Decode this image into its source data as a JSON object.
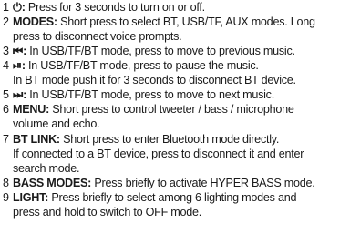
{
  "items": [
    {
      "number": "1",
      "icon": "power-icon",
      "icon_glyph": "⏻",
      "label": "",
      "sep": ":",
      "text": " Press for 3 seconds to turn on or off.",
      "cont": []
    },
    {
      "number": "2",
      "icon": "",
      "icon_glyph": "",
      "label": "MODES:",
      "text": " Short press to select BT, USB/TF, AUX modes. Long",
      "cont": [
        "press to disconnect voice prompts."
      ]
    },
    {
      "number": "3",
      "icon": "previous-track-icon",
      "icon_glyph": "⏮",
      "label": "",
      "sep": ":",
      "text": " In USB/TF/BT mode, press to move to previous music.",
      "cont": []
    },
    {
      "number": "4",
      "icon": "play-pause-icon",
      "icon_glyph": "⏯",
      "label": "",
      "sep": ":",
      "text": " In USB/TF/BT mode, press to pause the music.",
      "cont": [
        "In BT mode push it for 3 seconds to disconnect BT device."
      ]
    },
    {
      "number": "5",
      "icon": "next-track-icon",
      "icon_glyph": "⏭",
      "label": "",
      "sep": ":",
      "text": " In USB/TF/BT mode, press to move to next music.",
      "cont": []
    },
    {
      "number": "6",
      "icon": "",
      "icon_glyph": "",
      "label": "MENU:",
      "text": " Short press to control tweeter / bass / microphone",
      "cont": [
        "volume and echo."
      ]
    },
    {
      "number": "7",
      "icon": "",
      "icon_glyph": "",
      "label": "BT LINK:",
      "text": " Short press to enter Bluetooth mode directly.",
      "cont": [
        "If connected to a BT device, press to disconnect it and enter",
        "search mode."
      ]
    },
    {
      "number": "8",
      "icon": "",
      "icon_glyph": "",
      "label": "BASS MODES:",
      "text": " Press briefly to activate HYPER BASS mode.",
      "cont": []
    },
    {
      "number": "9",
      "icon": "",
      "icon_glyph": "",
      "label": "LIGHT:",
      "text": " Press briefly to select among 6 lighting modes and",
      "cont": [
        "press and hold to switch to OFF mode."
      ]
    }
  ]
}
